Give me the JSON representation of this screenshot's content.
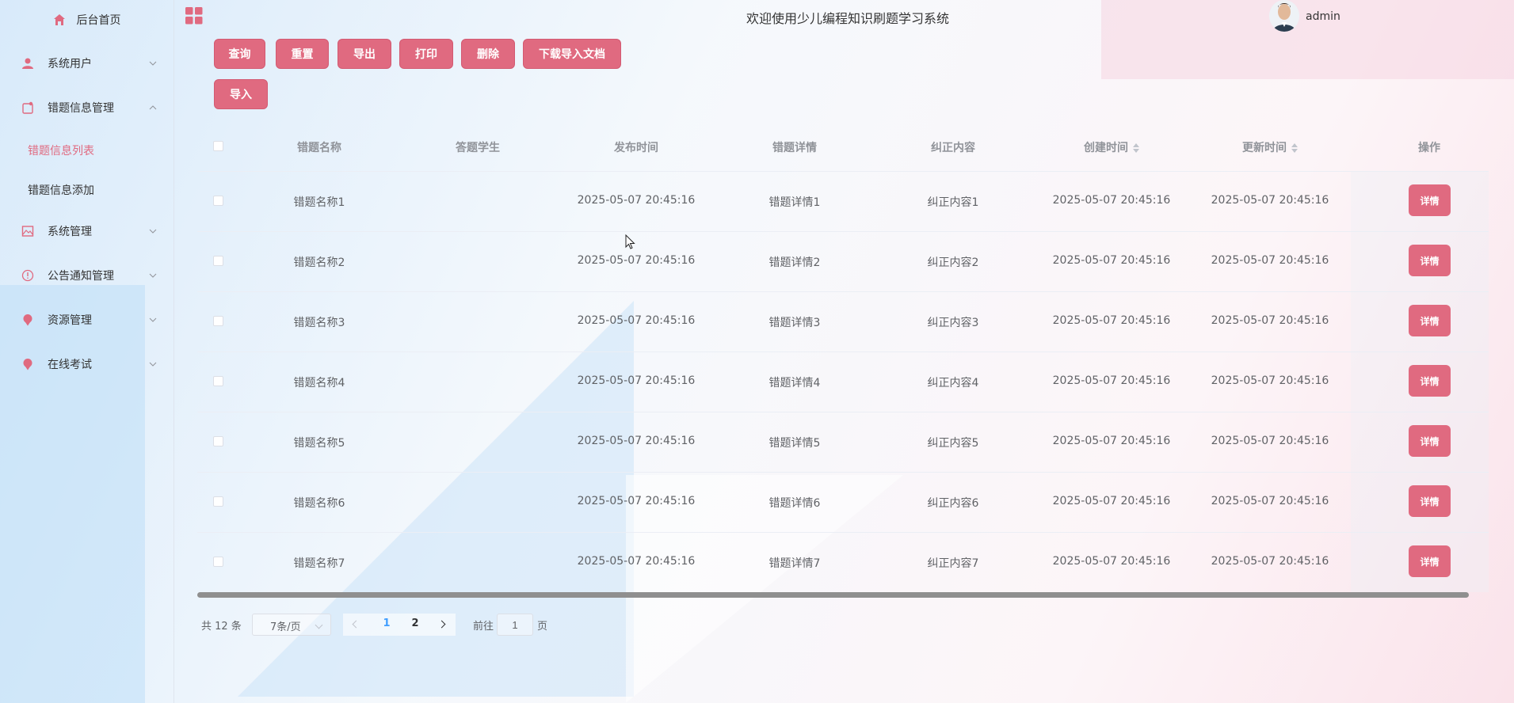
{
  "header": {
    "title": "欢迎使用少儿编程知识刷题学习系统",
    "username": "admin"
  },
  "sidebar": {
    "home": "后台首页",
    "items": [
      {
        "label": "系统用户",
        "icon": "user-icon"
      },
      {
        "label": "错题信息管理",
        "icon": "clipboard-icon",
        "expanded": true,
        "children": [
          {
            "label": "错题信息列表",
            "active": true
          },
          {
            "label": "错题信息添加"
          }
        ]
      },
      {
        "label": "系统管理",
        "icon": "image-icon"
      },
      {
        "label": "公告通知管理",
        "icon": "info-icon"
      },
      {
        "label": "资源管理",
        "icon": "pin-icon"
      },
      {
        "label": "在线考试",
        "icon": "pin-icon"
      }
    ]
  },
  "toolbar": {
    "query": "查询",
    "reset": "重置",
    "export": "导出",
    "print": "打印",
    "delete": "删除",
    "download_template": "下载导入文档",
    "import": "导入"
  },
  "table": {
    "columns": [
      "错题名称",
      "答题学生",
      "发布时间",
      "错题详情",
      "纠正内容",
      "创建时间",
      "更新时间",
      "操作"
    ],
    "detail_label": "详情",
    "rows": [
      {
        "name": "错题名称1",
        "student": "",
        "publish_time": "2025-05-07 20:45:16",
        "detail": "错题详情1",
        "correction": "纠正内容1",
        "created": "2025-05-07 20:45:16",
        "updated": "2025-05-07 20:45:16"
      },
      {
        "name": "错题名称2",
        "student": "",
        "publish_time": "2025-05-07 20:45:16",
        "detail": "错题详情2",
        "correction": "纠正内容2",
        "created": "2025-05-07 20:45:16",
        "updated": "2025-05-07 20:45:16"
      },
      {
        "name": "错题名称3",
        "student": "",
        "publish_time": "2025-05-07 20:45:16",
        "detail": "错题详情3",
        "correction": "纠正内容3",
        "created": "2025-05-07 20:45:16",
        "updated": "2025-05-07 20:45:16"
      },
      {
        "name": "错题名称4",
        "student": "",
        "publish_time": "2025-05-07 20:45:16",
        "detail": "错题详情4",
        "correction": "纠正内容4",
        "created": "2025-05-07 20:45:16",
        "updated": "2025-05-07 20:45:16"
      },
      {
        "name": "错题名称5",
        "student": "",
        "publish_time": "2025-05-07 20:45:16",
        "detail": "错题详情5",
        "correction": "纠正内容5",
        "created": "2025-05-07 20:45:16",
        "updated": "2025-05-07 20:45:16"
      },
      {
        "name": "错题名称6",
        "student": "",
        "publish_time": "2025-05-07 20:45:16",
        "detail": "错题详情6",
        "correction": "纠正内容6",
        "created": "2025-05-07 20:45:16",
        "updated": "2025-05-07 20:45:16"
      },
      {
        "name": "错题名称7",
        "student": "",
        "publish_time": "2025-05-07 20:45:16",
        "detail": "错题详情7",
        "correction": "纠正内容7",
        "created": "2025-05-07 20:45:16",
        "updated": "2025-05-07 20:45:16"
      }
    ]
  },
  "pagination": {
    "total": "共 12 条",
    "page_size": "7条/页",
    "pages": [
      "1",
      "2"
    ],
    "current_page": "1",
    "goto_label": "前往",
    "goto_value": "1",
    "page_unit": "页"
  },
  "colors": {
    "accent": "#e06a80",
    "active_page": "#409eff"
  }
}
